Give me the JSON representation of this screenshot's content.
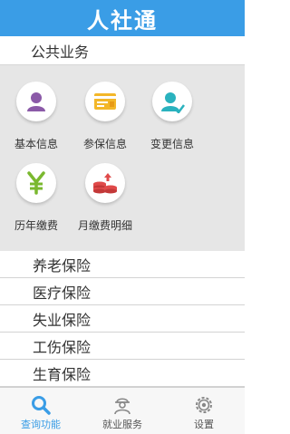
{
  "header": {
    "title": "人社通"
  },
  "section": {
    "title": "公共业务"
  },
  "tiles": [
    {
      "label": "基本信息",
      "icon": "person-icon"
    },
    {
      "label": "参保信息",
      "icon": "card-icon"
    },
    {
      "label": "变更信息",
      "icon": "person-edit-icon"
    },
    {
      "label": "历年缴费",
      "icon": "yen-icon"
    },
    {
      "label": "月缴费明细",
      "icon": "coins-icon"
    }
  ],
  "list": {
    "items": [
      "养老保险",
      "医疗保险",
      "失业保险",
      "工伤保险",
      "生育保险"
    ]
  },
  "tabbar": {
    "items": [
      {
        "label": "查询功能",
        "icon": "search-icon",
        "active": true
      },
      {
        "label": "就业服务",
        "icon": "worker-icon",
        "active": false
      },
      {
        "label": "设置",
        "icon": "gear-icon",
        "active": false
      }
    ]
  },
  "colors": {
    "brand": "#3a9de6",
    "grid_bg": "#e6e6e6",
    "icon_purple": "#8b5aa8",
    "icon_yellow": "#f3b729",
    "icon_teal": "#2ab2be",
    "icon_green": "#7ab82f",
    "icon_red": "#e04a4a"
  }
}
